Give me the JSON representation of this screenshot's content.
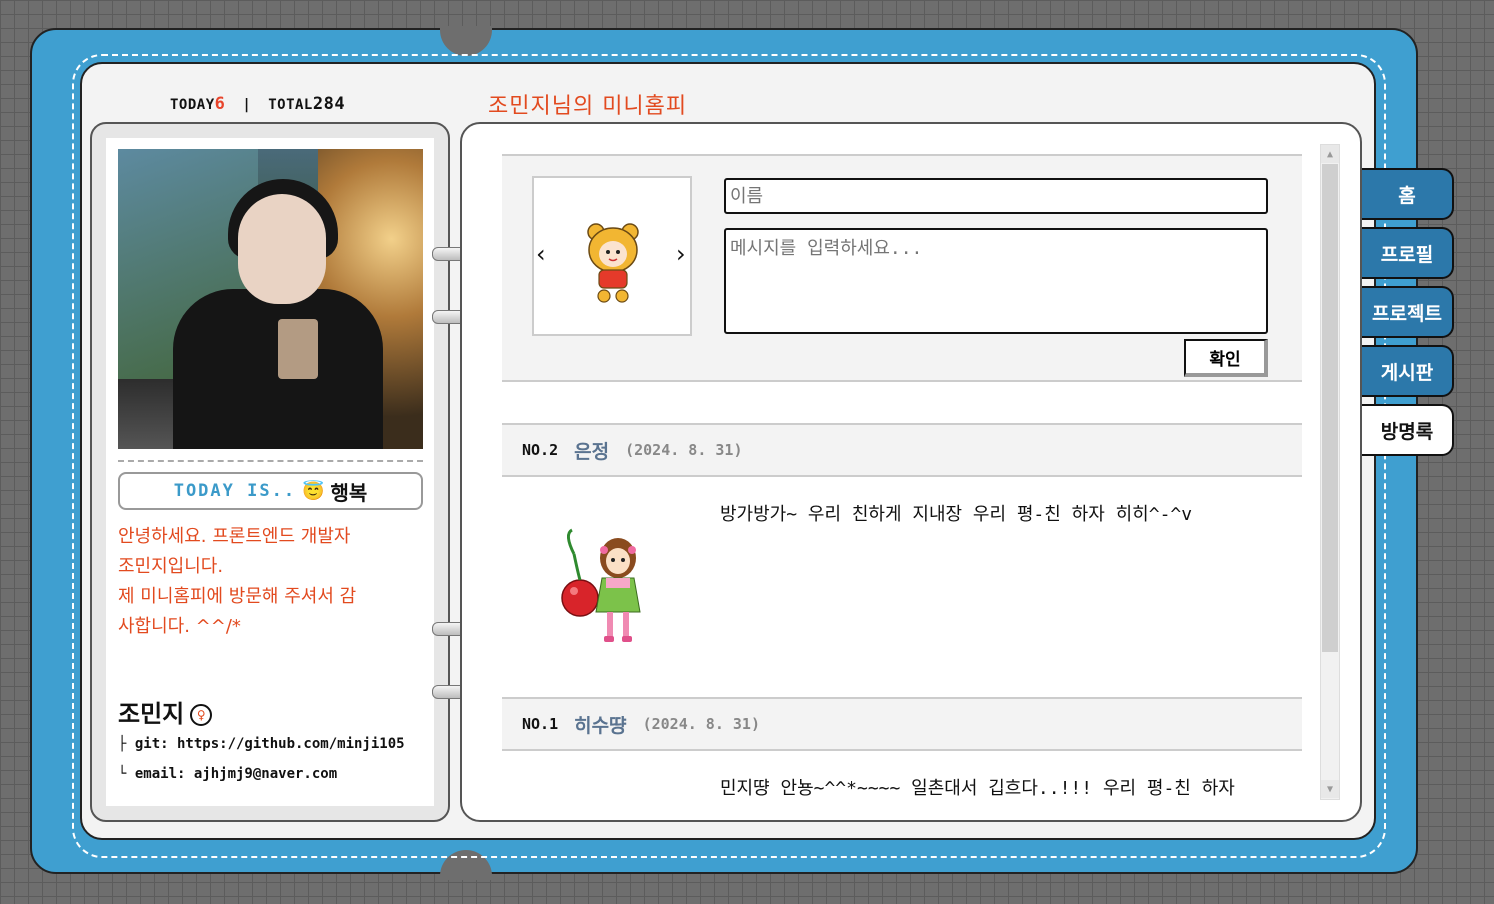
{
  "visitors": {
    "today_label": "TODAY",
    "today_count": "6",
    "divider": "|",
    "total_label": "TOTAL",
    "total_count": "284"
  },
  "site_title": "조민지님의 미니홈피",
  "profile": {
    "today_is_label": "TODAY IS..",
    "mood_emoji": "😇",
    "mood": "행복",
    "intro_lines": [
      "안녕하세요. 프론트엔드 개발자",
      "조민지입니다.",
      "제 미니홈피에 방문해 주셔서 감",
      "사합니다. ^^/*"
    ],
    "name": "조민지",
    "gender_icon": "♀",
    "github": "├ git: https://github.com/minji105",
    "email": "└ email: ajhjmj9@naver.com"
  },
  "guestbook_form": {
    "prev_arrow": "‹",
    "next_arrow": "›",
    "avatar_icon": "pooh-avatar-icon",
    "name_placeholder": "이름",
    "message_placeholder": "메시지를 입력하세요...",
    "submit_label": "확인"
  },
  "entries": [
    {
      "no": "NO.2",
      "writer": "은정",
      "date": "(2024. 8. 31)",
      "message": "방가방가~ 우리 친하게 지내장 우리 평-친 하자 히히^-^v",
      "avatar_icon": "cherry-girl-icon"
    },
    {
      "no": "NO.1",
      "writer": "히수땽",
      "date": "(2024. 8. 31)",
      "message": "민지땽 안뇽~^^*~~~~ 일촌대서 깁흐다..!!! 우리 평-친 하자"
    }
  ],
  "tabs": [
    {
      "label": "홈",
      "active": false
    },
    {
      "label": "프로필",
      "active": false
    },
    {
      "label": "프로젝트",
      "active": false
    },
    {
      "label": "게시판",
      "active": false
    },
    {
      "label": "방명록",
      "active": true
    }
  ],
  "colors": {
    "book": "#3f9fd0",
    "accent": "#e24a1f",
    "tab": "#2c78aa",
    "writer": "#5a7390"
  }
}
